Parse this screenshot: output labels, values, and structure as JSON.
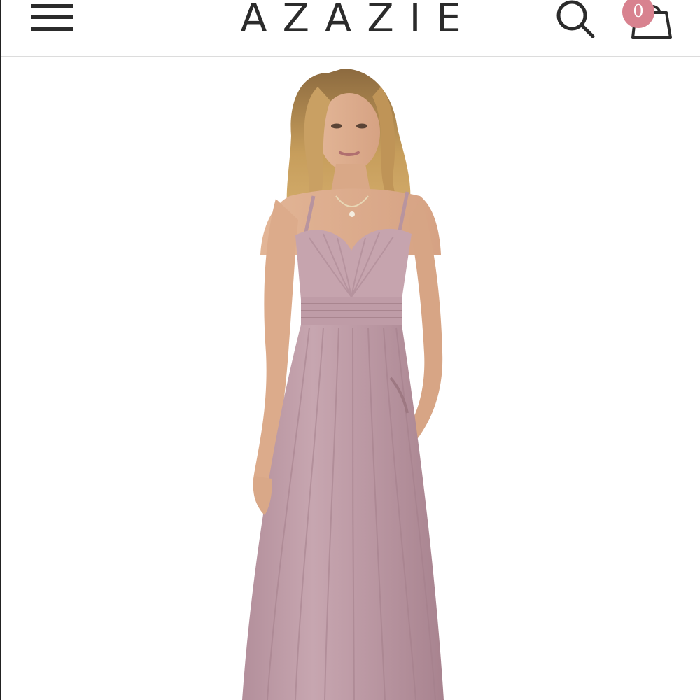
{
  "header": {
    "brand": "AZAZIE",
    "cart_count": "0",
    "icons": {
      "menu": "hamburger-menu-icon",
      "search": "search-icon",
      "cart": "shopping-bag-icon"
    }
  },
  "product": {
    "image": "model-wearing-long-mauve-chiffon-bridesmaid-dress",
    "dress_color": "#c09ea8"
  },
  "colors": {
    "accent_badge": "#d8828f",
    "text": "#2b2b2b",
    "divider": "#dcdcdc"
  }
}
